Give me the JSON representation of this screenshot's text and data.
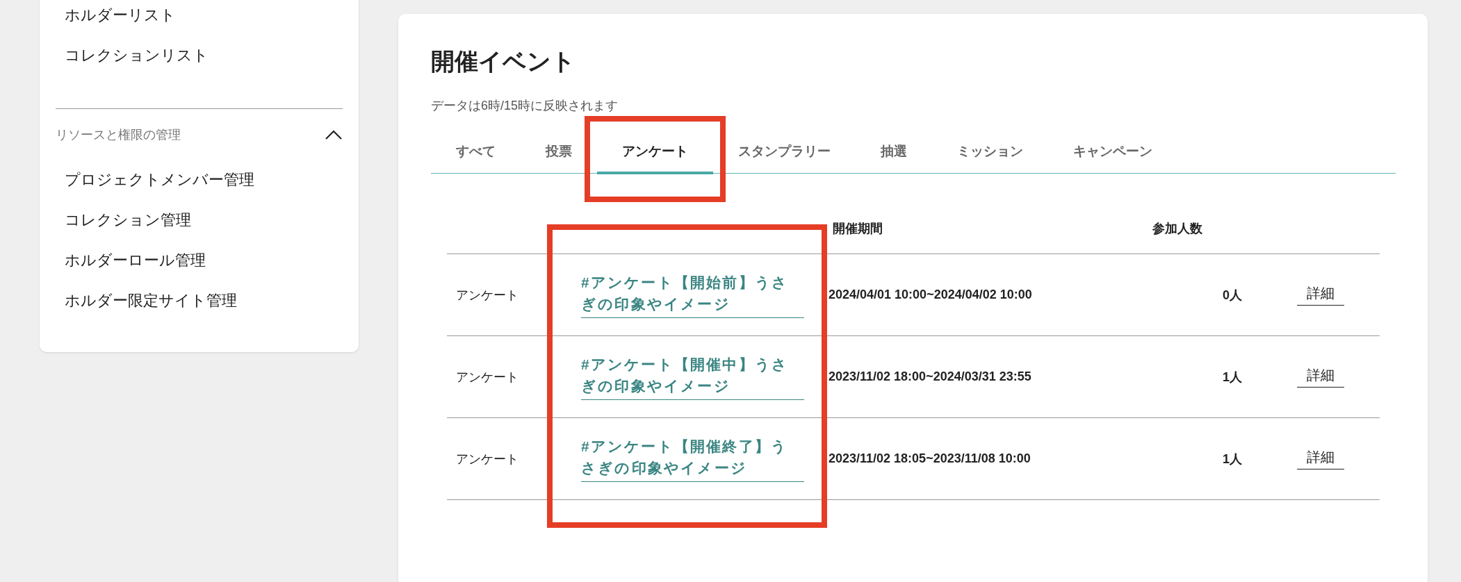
{
  "sidebar": {
    "items": [
      {
        "label": "ホルダーリスト"
      },
      {
        "label": "コレクションリスト"
      }
    ],
    "sections": [
      {
        "title": "リソースと権限の管理",
        "expanded": true,
        "items": [
          {
            "label": "プロジェクトメンバー管理"
          },
          {
            "label": "コレクション管理"
          },
          {
            "label": "ホルダーロール管理"
          },
          {
            "label": "ホルダー限定サイト管理"
          }
        ]
      }
    ]
  },
  "main": {
    "title": "開催イベント",
    "note": "データは6時/15時に反映されます",
    "tabs": [
      {
        "label": "すべて",
        "selected": false,
        "highlighted": false
      },
      {
        "label": "投票",
        "selected": false,
        "highlighted": false
      },
      {
        "label": "アンケート",
        "selected": true,
        "highlighted": true
      },
      {
        "label": "スタンプラリー",
        "selected": false,
        "highlighted": false
      },
      {
        "label": "抽選",
        "selected": false,
        "highlighted": false
      },
      {
        "label": "ミッション",
        "selected": false,
        "highlighted": false
      },
      {
        "label": "キャンペーン",
        "selected": false,
        "highlighted": false
      }
    ],
    "table": {
      "columns": [
        {
          "highlighted": false
        },
        {
          "highlighted": true
        },
        {
          "label": "開催期間",
          "highlighted": false
        },
        {
          "label": "参加人数",
          "highlighted": false
        },
        {
          "highlighted": false
        }
      ],
      "rows": [
        {
          "type": "アンケート",
          "title": "#アンケート【開始前】うさぎの印象やイメージ",
          "period": "2024/04/01 10:00~2024/04/02 10:00",
          "participants": "0人",
          "action": "詳細"
        },
        {
          "type": "アンケート",
          "title": "#アンケート【開催中】うさぎの印象やイメージ",
          "period": "2023/11/02 18:00~2024/03/31 23:55",
          "participants": "1人",
          "action": "詳細"
        },
        {
          "type": "アンケート",
          "title": "#アンケート【開催終了】うさぎの印象やイメージ",
          "period": "2023/11/02 18:05~2023/11/08 10:00",
          "participants": "1人",
          "action": "詳細"
        }
      ]
    }
  }
}
